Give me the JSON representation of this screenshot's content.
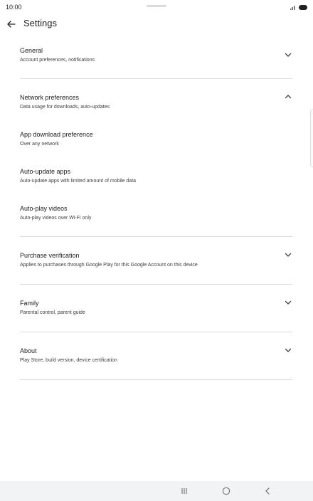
{
  "status_bar": {
    "time": "10:00"
  },
  "header": {
    "title": "Settings"
  },
  "sections": {
    "general": {
      "title": "General",
      "subtitle": "Account preferences, notifications"
    },
    "network": {
      "title": "Network preferences",
      "subtitle": "Data usage for downloads, auto-updates",
      "items": [
        {
          "title": "App download preference",
          "subtitle": "Over any network"
        },
        {
          "title": "Auto-update apps",
          "subtitle": "Auto-update apps with limited amount of mobile data"
        },
        {
          "title": "Auto-play videos",
          "subtitle": "Auto-play videos over Wi-Fi only"
        }
      ]
    },
    "purchase": {
      "title": "Purchase verification",
      "subtitle": "Applies to purchases through Google Play for this Google Account on this device"
    },
    "family": {
      "title": "Family",
      "subtitle": "Parental control, parent guide"
    },
    "about": {
      "title": "About",
      "subtitle": "Play Store, build version, device certification"
    }
  },
  "icons": {
    "back": "arrow-left-icon",
    "expand": "chevron-down-icon",
    "collapse": "chevron-up-icon",
    "nav_recents": "recents-icon",
    "nav_home": "home-icon",
    "nav_back": "nav-back-icon"
  },
  "colors": {
    "text_primary": "#202124",
    "text_secondary": "#3c4043",
    "divider": "#dadce0",
    "nav_bar_background": "#f1f3f4"
  }
}
